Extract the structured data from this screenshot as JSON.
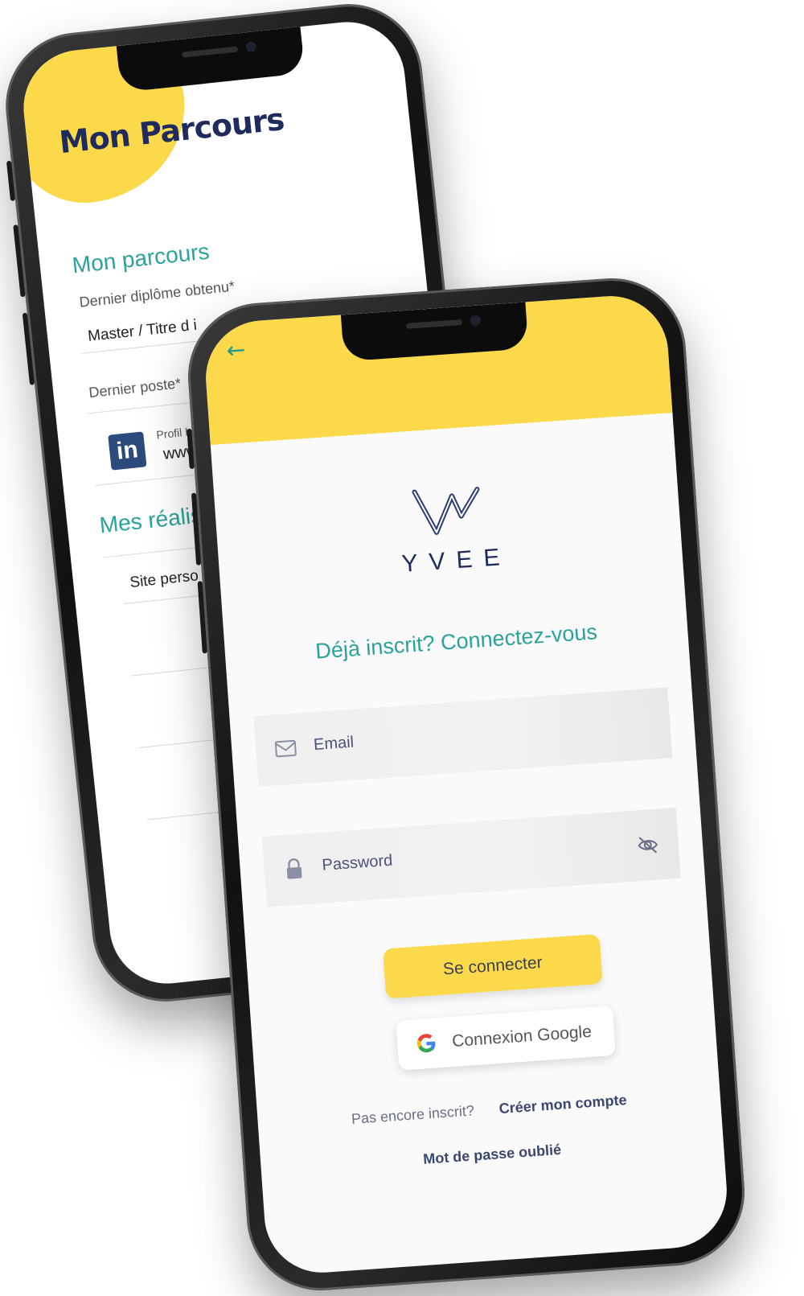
{
  "back_screen": {
    "title": "Mon Parcours",
    "section_parcours": "Mon parcours",
    "field_diplome_label": "Dernier diplôme obtenu*",
    "field_diplome_value": "Master / Titre d i",
    "field_poste_label": "Dernier poste*",
    "linkedin_label": "Profil Linke",
    "linkedin_value": "www.lin",
    "section_realisations": "Mes réalisa",
    "site_perso": "Site perso",
    "linkedin_icon_text": "in",
    "back_icon": "arrow-left-icon"
  },
  "front_screen": {
    "brand": "YVEE",
    "heading": "Déjà inscrit? Connectez-vous",
    "email_placeholder": "Email",
    "password_placeholder": "Password",
    "login_button": "Se connecter",
    "google_button": "Connexion Google",
    "signup_question": "Pas encore inscrit?",
    "signup_link": "Créer mon compte",
    "forgot_link": "Mot de passe oublié",
    "icons": {
      "back": "arrow-left-icon",
      "email": "mail-icon",
      "password": "lock-icon",
      "toggle": "eye-off-icon",
      "google": "google-icon"
    }
  },
  "colors": {
    "accent_yellow": "#fbd94a",
    "teal": "#2aa39a",
    "navy": "#1f2b5c"
  }
}
